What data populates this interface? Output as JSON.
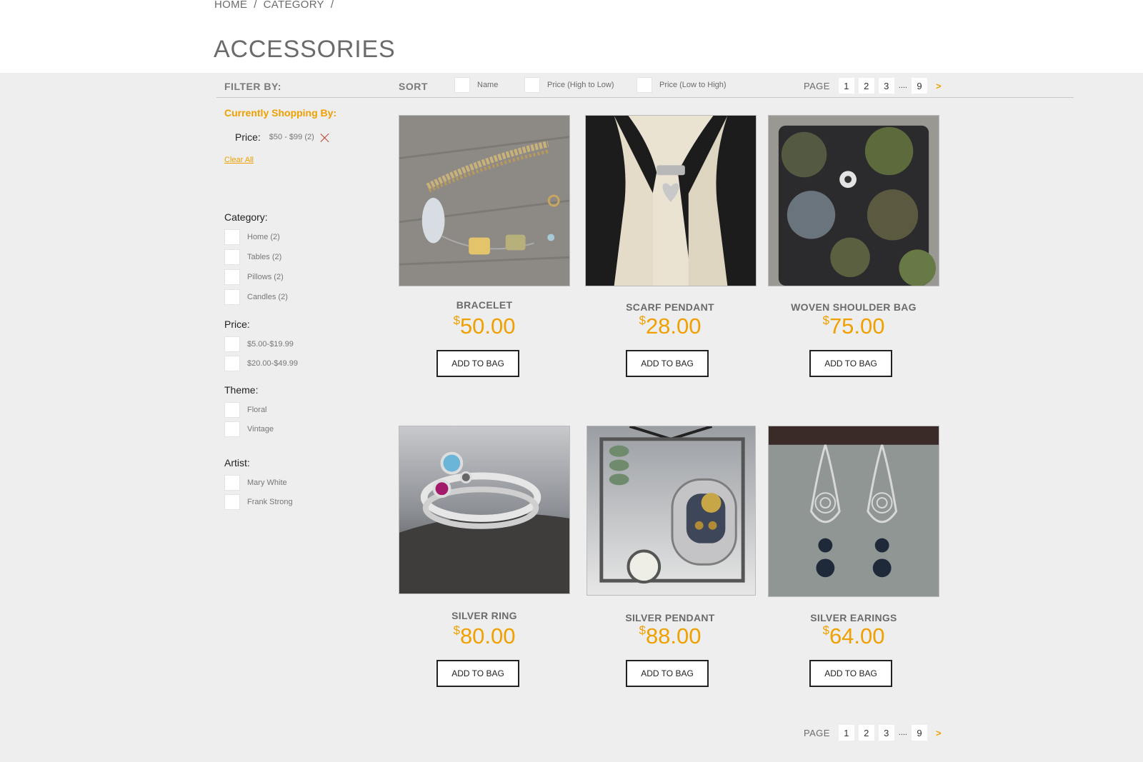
{
  "breadcrumb": [
    "HOME",
    "CATEGORY"
  ],
  "breadcrumb_sep": "/",
  "page_title": "ACCESSORIES",
  "toolbar": {
    "filter_label": "FILTER BY:",
    "sort_label": "SORT",
    "sort_options": [
      "Name",
      "Price (High to Low)",
      "Price (Low to High)"
    ]
  },
  "pagination": {
    "label": "PAGE",
    "pages": [
      "1",
      "2",
      "3"
    ],
    "ellipsis": "....",
    "last": "9",
    "next": ">"
  },
  "currently_shopping": {
    "title": "Currently Shopping By:",
    "filter_label": "Price:",
    "filter_value": "$50 - $99  (2)",
    "clear_all": "Clear All"
  },
  "filters": {
    "category": {
      "title": "Category:",
      "items": [
        "Home  (2)",
        "Tables  (2)",
        "Pillows  (2)",
        "Candles (2)"
      ]
    },
    "price": {
      "title": "Price:",
      "items": [
        "$5.00-$19.99",
        "$20.00-$49.99"
      ]
    },
    "theme": {
      "title": "Theme:",
      "items": [
        "Floral",
        "Vintage"
      ]
    },
    "artist": {
      "title": "Artist:",
      "items": [
        "Mary White",
        "Frank Strong"
      ]
    }
  },
  "products": [
    {
      "name": "BRACELET",
      "currency": "$",
      "price": "50.00",
      "button": "ADD TO BAG",
      "image_icon": "bracelet-photo"
    },
    {
      "name": "SCARF PENDANT",
      "currency": "$",
      "price": "28.00",
      "button": "ADD TO BAG",
      "image_icon": "scarf-pendant-photo"
    },
    {
      "name": "WOVEN SHOULDER BAG",
      "currency": "$",
      "price": "75.00",
      "button": "ADD TO BAG",
      "image_icon": "shoulder-bag-photo"
    },
    {
      "name": "SILVER RING",
      "currency": "$",
      "price": "80.00",
      "button": "ADD TO BAG",
      "image_icon": "silver-ring-photo"
    },
    {
      "name": "SILVER PENDANT",
      "currency": "$",
      "price": "88.00",
      "button": "ADD TO BAG",
      "image_icon": "silver-pendant-photo"
    },
    {
      "name": "SILVER EARINGS",
      "currency": "$",
      "price": "64.00",
      "button": "ADD TO BAG",
      "image_icon": "silver-earrings-photo"
    }
  ],
  "colors": {
    "accent": "#f0a000",
    "background": "#eeeeee",
    "text": "#6b6b6b",
    "remove": "#c0392b"
  }
}
